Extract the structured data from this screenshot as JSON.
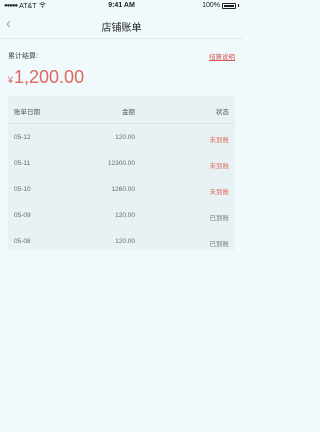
{
  "status_bar": {
    "carrier": "AT&T",
    "time": "9:41 AM",
    "battery": "100%"
  },
  "nav": {
    "back_icon": "chevron-left",
    "title": "店铺账单"
  },
  "summary": {
    "label": "累计结算:",
    "link": "结算说明",
    "currency": "¥",
    "amount": "1,200.00"
  },
  "table": {
    "headers": {
      "date": "账单日期",
      "amount": "金额",
      "status": "状态"
    },
    "rows": [
      {
        "date": "05-12",
        "amount": "120.00",
        "status": "未到账",
        "state": "unpaid"
      },
      {
        "date": "05-11",
        "amount": "12300.00",
        "status": "未到账",
        "state": "unpaid"
      },
      {
        "date": "05-10",
        "amount": "1260.00",
        "status": "未到账",
        "state": "unpaid"
      },
      {
        "date": "05-09",
        "amount": "120.00",
        "status": "已到账",
        "state": "paid"
      },
      {
        "date": "05-08",
        "amount": "120.00",
        "status": "已到账",
        "state": "paid"
      }
    ]
  },
  "colors": {
    "accent": "#e0685d",
    "background": "#f0f9fb",
    "table_bg": "#e8f2f4"
  }
}
